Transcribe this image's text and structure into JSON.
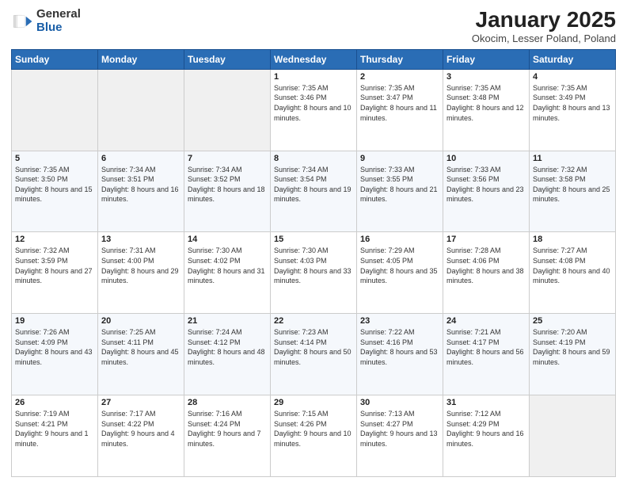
{
  "logo": {
    "general": "General",
    "blue": "Blue"
  },
  "header": {
    "title": "January 2025",
    "subtitle": "Okocim, Lesser Poland, Poland"
  },
  "weekdays": [
    "Sunday",
    "Monday",
    "Tuesday",
    "Wednesday",
    "Thursday",
    "Friday",
    "Saturday"
  ],
  "weeks": [
    [
      {
        "day": "",
        "empty": true
      },
      {
        "day": "",
        "empty": true
      },
      {
        "day": "",
        "empty": true
      },
      {
        "day": "1",
        "sunrise": "7:35 AM",
        "sunset": "3:46 PM",
        "daylight": "8 hours and 10 minutes."
      },
      {
        "day": "2",
        "sunrise": "7:35 AM",
        "sunset": "3:47 PM",
        "daylight": "8 hours and 11 minutes."
      },
      {
        "day": "3",
        "sunrise": "7:35 AM",
        "sunset": "3:48 PM",
        "daylight": "8 hours and 12 minutes."
      },
      {
        "day": "4",
        "sunrise": "7:35 AM",
        "sunset": "3:49 PM",
        "daylight": "8 hours and 13 minutes."
      }
    ],
    [
      {
        "day": "5",
        "sunrise": "7:35 AM",
        "sunset": "3:50 PM",
        "daylight": "8 hours and 15 minutes."
      },
      {
        "day": "6",
        "sunrise": "7:34 AM",
        "sunset": "3:51 PM",
        "daylight": "8 hours and 16 minutes."
      },
      {
        "day": "7",
        "sunrise": "7:34 AM",
        "sunset": "3:52 PM",
        "daylight": "8 hours and 18 minutes."
      },
      {
        "day": "8",
        "sunrise": "7:34 AM",
        "sunset": "3:54 PM",
        "daylight": "8 hours and 19 minutes."
      },
      {
        "day": "9",
        "sunrise": "7:33 AM",
        "sunset": "3:55 PM",
        "daylight": "8 hours and 21 minutes."
      },
      {
        "day": "10",
        "sunrise": "7:33 AM",
        "sunset": "3:56 PM",
        "daylight": "8 hours and 23 minutes."
      },
      {
        "day": "11",
        "sunrise": "7:32 AM",
        "sunset": "3:58 PM",
        "daylight": "8 hours and 25 minutes."
      }
    ],
    [
      {
        "day": "12",
        "sunrise": "7:32 AM",
        "sunset": "3:59 PM",
        "daylight": "8 hours and 27 minutes."
      },
      {
        "day": "13",
        "sunrise": "7:31 AM",
        "sunset": "4:00 PM",
        "daylight": "8 hours and 29 minutes."
      },
      {
        "day": "14",
        "sunrise": "7:30 AM",
        "sunset": "4:02 PM",
        "daylight": "8 hours and 31 minutes."
      },
      {
        "day": "15",
        "sunrise": "7:30 AM",
        "sunset": "4:03 PM",
        "daylight": "8 hours and 33 minutes."
      },
      {
        "day": "16",
        "sunrise": "7:29 AM",
        "sunset": "4:05 PM",
        "daylight": "8 hours and 35 minutes."
      },
      {
        "day": "17",
        "sunrise": "7:28 AM",
        "sunset": "4:06 PM",
        "daylight": "8 hours and 38 minutes."
      },
      {
        "day": "18",
        "sunrise": "7:27 AM",
        "sunset": "4:08 PM",
        "daylight": "8 hours and 40 minutes."
      }
    ],
    [
      {
        "day": "19",
        "sunrise": "7:26 AM",
        "sunset": "4:09 PM",
        "daylight": "8 hours and 43 minutes."
      },
      {
        "day": "20",
        "sunrise": "7:25 AM",
        "sunset": "4:11 PM",
        "daylight": "8 hours and 45 minutes."
      },
      {
        "day": "21",
        "sunrise": "7:24 AM",
        "sunset": "4:12 PM",
        "daylight": "8 hours and 48 minutes."
      },
      {
        "day": "22",
        "sunrise": "7:23 AM",
        "sunset": "4:14 PM",
        "daylight": "8 hours and 50 minutes."
      },
      {
        "day": "23",
        "sunrise": "7:22 AM",
        "sunset": "4:16 PM",
        "daylight": "8 hours and 53 minutes."
      },
      {
        "day": "24",
        "sunrise": "7:21 AM",
        "sunset": "4:17 PM",
        "daylight": "8 hours and 56 minutes."
      },
      {
        "day": "25",
        "sunrise": "7:20 AM",
        "sunset": "4:19 PM",
        "daylight": "8 hours and 59 minutes."
      }
    ],
    [
      {
        "day": "26",
        "sunrise": "7:19 AM",
        "sunset": "4:21 PM",
        "daylight": "9 hours and 1 minute."
      },
      {
        "day": "27",
        "sunrise": "7:17 AM",
        "sunset": "4:22 PM",
        "daylight": "9 hours and 4 minutes."
      },
      {
        "day": "28",
        "sunrise": "7:16 AM",
        "sunset": "4:24 PM",
        "daylight": "9 hours and 7 minutes."
      },
      {
        "day": "29",
        "sunrise": "7:15 AM",
        "sunset": "4:26 PM",
        "daylight": "9 hours and 10 minutes."
      },
      {
        "day": "30",
        "sunrise": "7:13 AM",
        "sunset": "4:27 PM",
        "daylight": "9 hours and 13 minutes."
      },
      {
        "day": "31",
        "sunrise": "7:12 AM",
        "sunset": "4:29 PM",
        "daylight": "9 hours and 16 minutes."
      },
      {
        "day": "",
        "empty": true
      }
    ]
  ],
  "labels": {
    "sunrise": "Sunrise:",
    "sunset": "Sunset:",
    "daylight": "Daylight:"
  }
}
